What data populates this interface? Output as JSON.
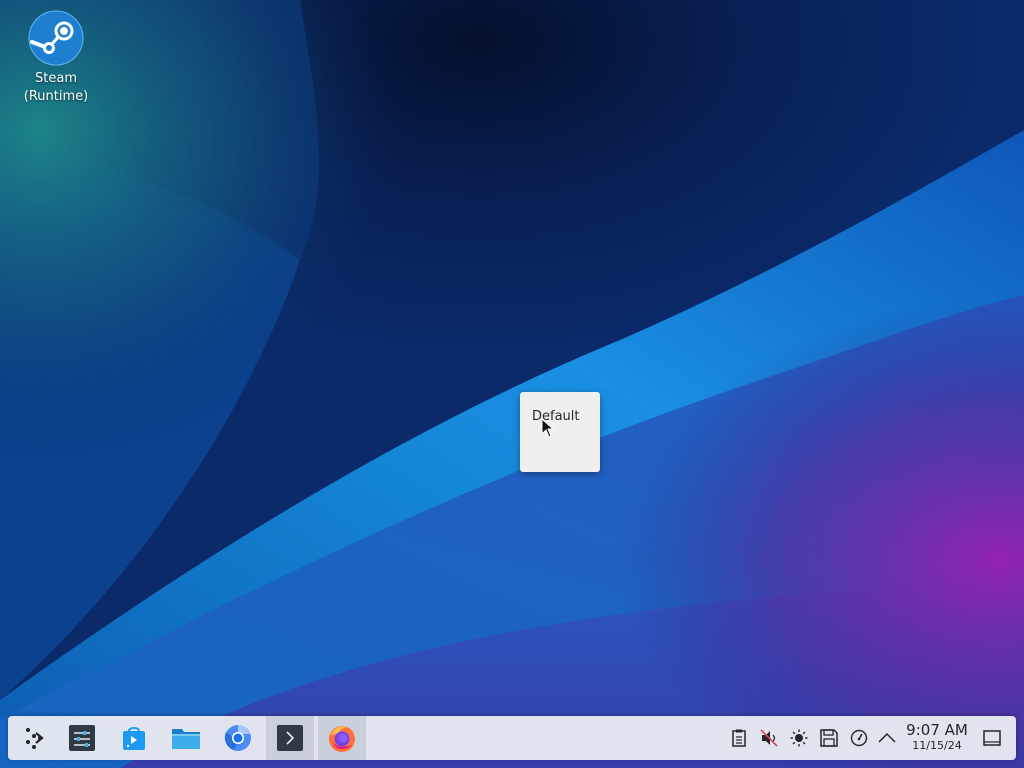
{
  "desktop": {
    "icons": [
      {
        "label_line1": "Steam",
        "label_line2": "(Runtime)",
        "icon": "steam-icon"
      }
    ]
  },
  "popup_menu": {
    "items": [
      "Default"
    ]
  },
  "taskbar": {
    "launchers": [
      {
        "name": "application-launcher",
        "icon": "kde-launcher-icon"
      },
      {
        "name": "system-settings",
        "icon": "settings-sliders-icon"
      },
      {
        "name": "discover",
        "icon": "discover-store-icon"
      },
      {
        "name": "file-manager",
        "icon": "folder-icon"
      },
      {
        "name": "chromium",
        "icon": "chromium-icon"
      },
      {
        "name": "terminal",
        "icon": "terminal-icon",
        "active": true
      },
      {
        "name": "firefox",
        "icon": "firefox-icon",
        "active": true
      }
    ],
    "tray": [
      {
        "icon": "clipboard-icon"
      },
      {
        "icon": "volume-muted-icon"
      },
      {
        "icon": "brightness-icon"
      },
      {
        "icon": "storage-icon"
      },
      {
        "icon": "performance-gauge-icon"
      },
      {
        "icon": "chevron-up-icon"
      }
    ],
    "clock": {
      "time": "9:07 AM",
      "date": "11/15/24"
    },
    "show_desktop": {
      "icon": "show-desktop-icon"
    }
  },
  "colors": {
    "panel_bg": "#e8eaf0",
    "accent_blue": "#1d99f3",
    "wallpaper_base": "#0a2a6a",
    "wallpaper_purple": "#7a1fa0"
  }
}
